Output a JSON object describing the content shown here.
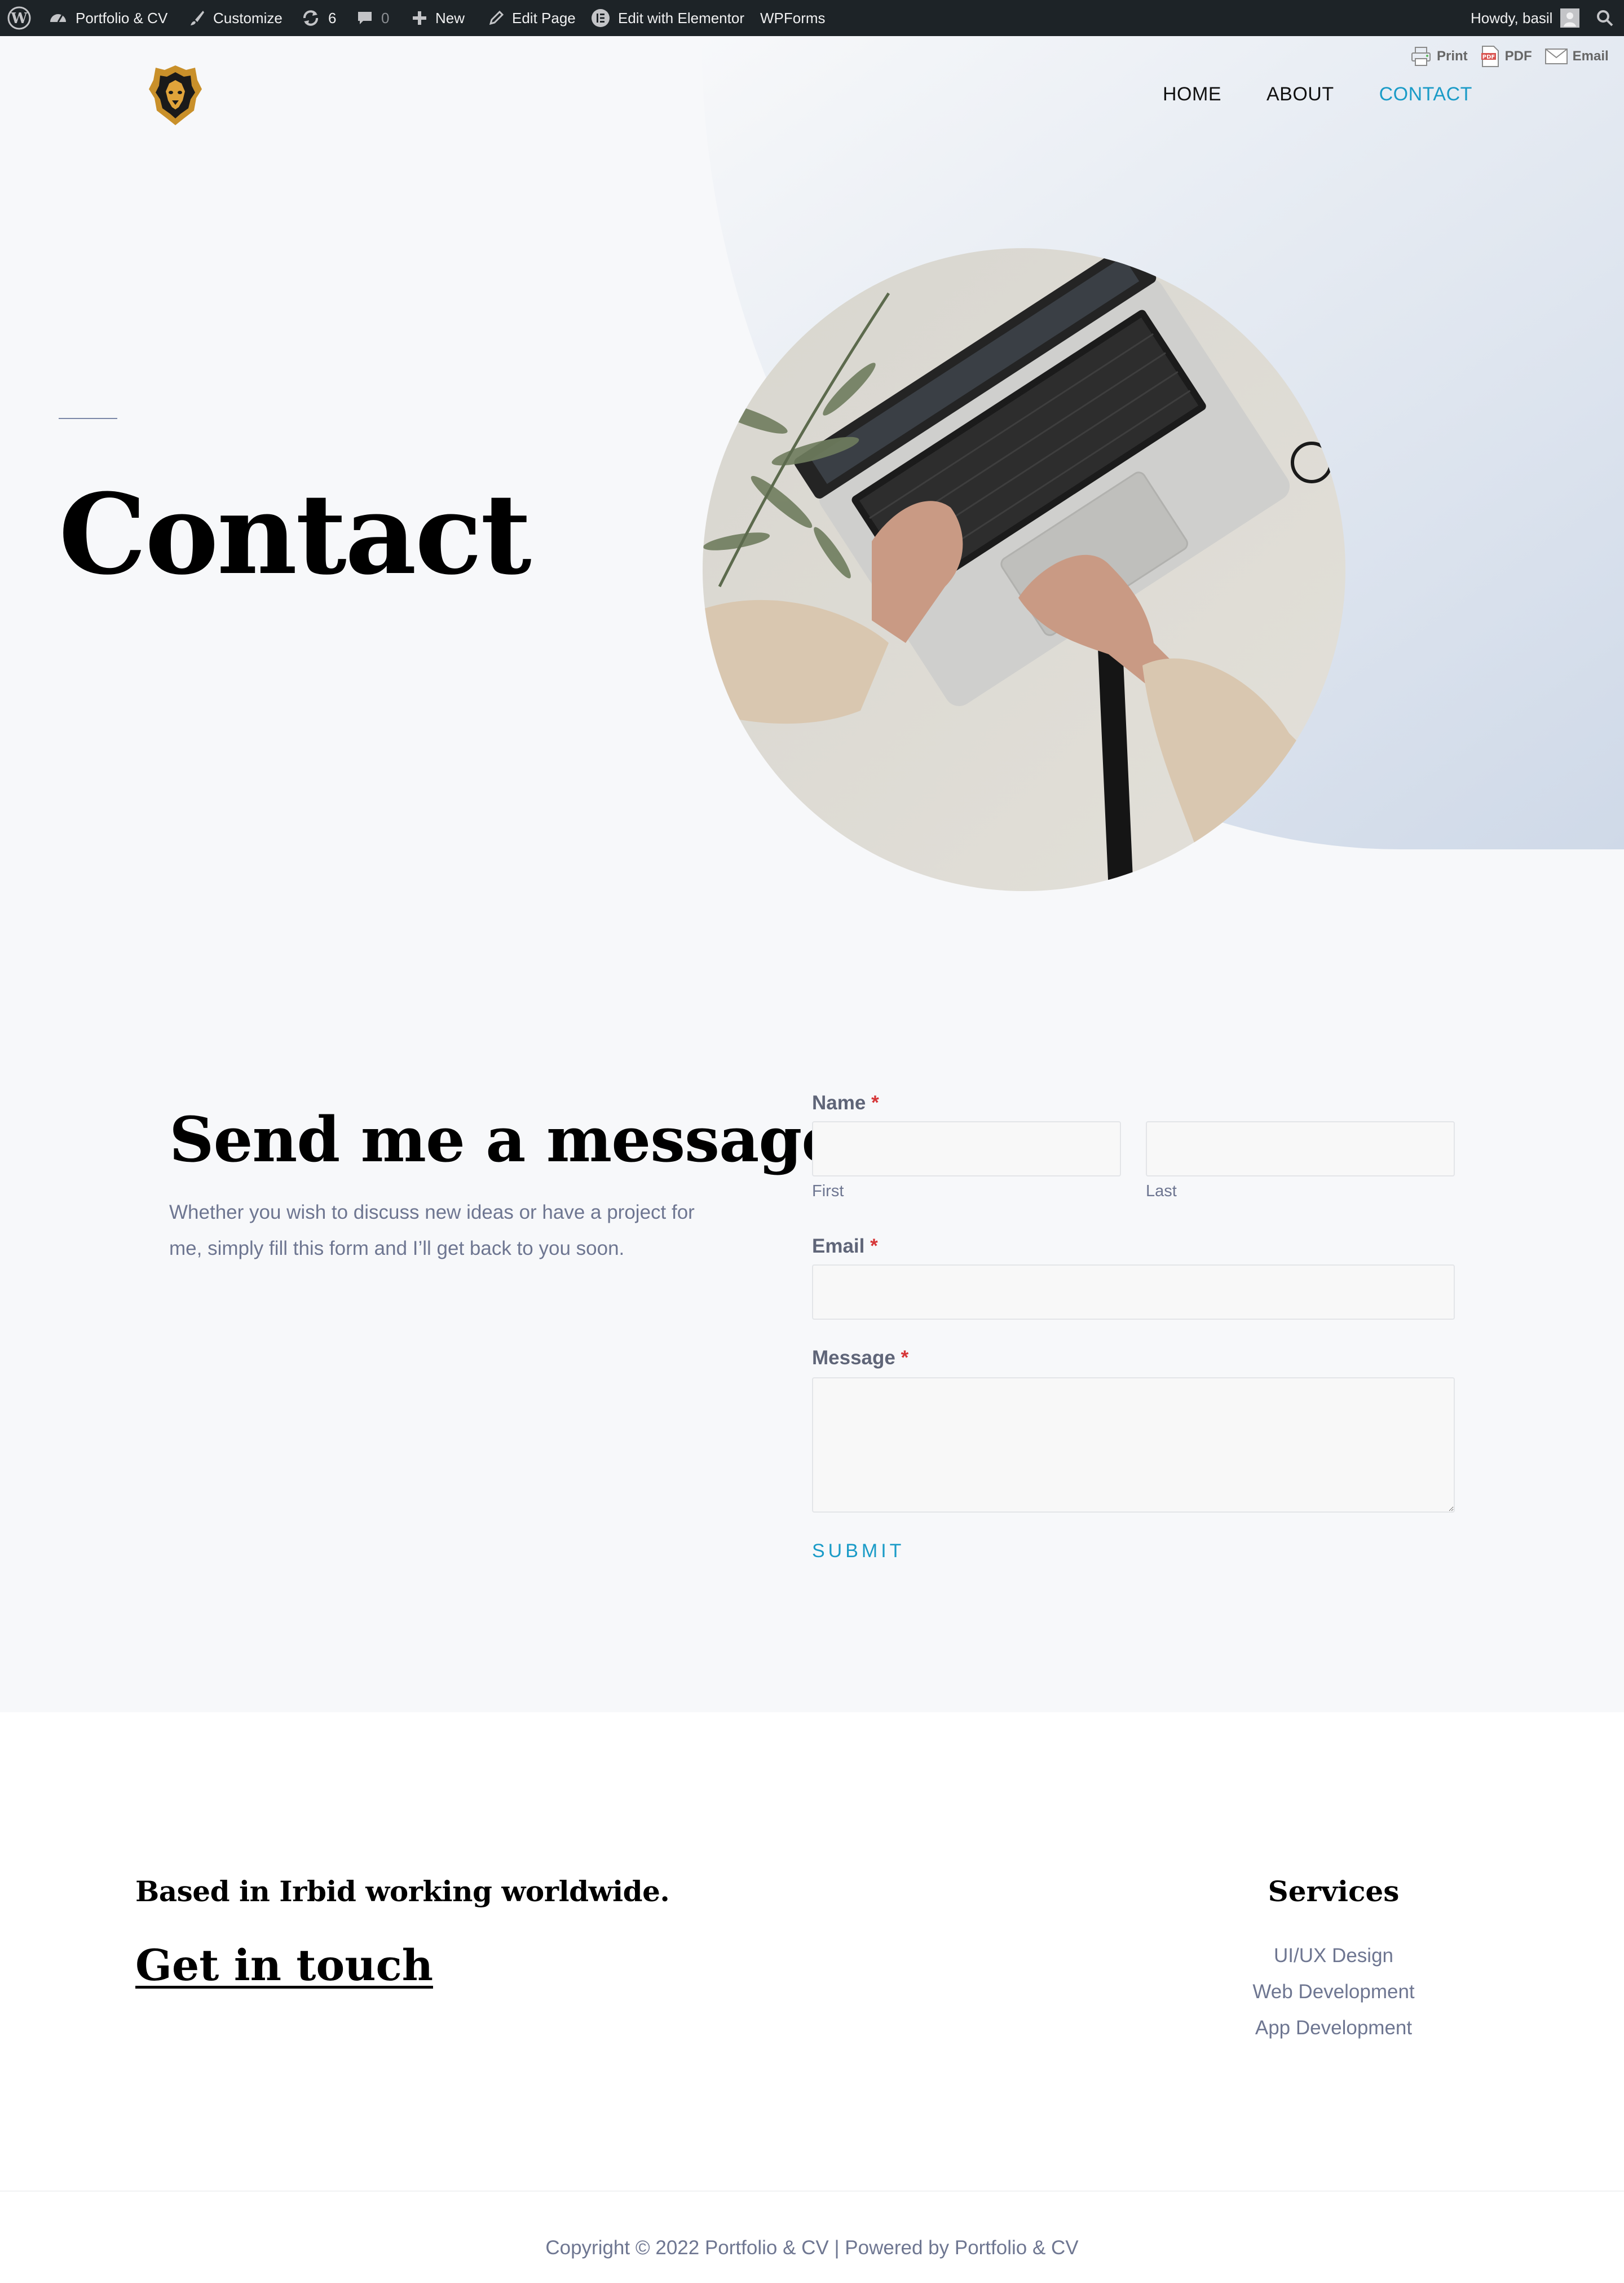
{
  "admin_bar": {
    "site_name": "Portfolio & CV",
    "customize": "Customize",
    "updates": "6",
    "comments": "0",
    "new": "New",
    "edit_page": "Edit Page",
    "elementor": "Edit with Elementor",
    "wpforms": "WPForms",
    "howdy": "Howdy, basil"
  },
  "print_tools": {
    "print": "Print",
    "pdf": "PDF",
    "email": "Email"
  },
  "nav": {
    "home": "HOME",
    "about": "ABOUT",
    "contact": "CONTACT"
  },
  "hero": {
    "title": "Contact"
  },
  "message": {
    "title": "Send me a message",
    "description": "Whether you wish to discuss new ideas or have a project for me, simply fill this form and I’ll get back to you soon."
  },
  "form": {
    "name_label": "Name",
    "first_sublabel": "First",
    "last_sublabel": "Last",
    "email_label": "Email",
    "message_label": "Message",
    "required_mark": "*",
    "submit": "SUBMIT"
  },
  "footer": {
    "tagline": "Based in Irbid working worldwide.",
    "get_in_touch": "Get in touch",
    "services_title": "Services",
    "services": [
      "UI/UX Design",
      "Web Development",
      "App Development"
    ],
    "copyright": "Copyright © 2022 Portfolio & CV | Powered by Portfolio & CV"
  },
  "colors": {
    "accent": "#1a9bc7",
    "admin_bar": "#1d2327",
    "page_bg": "#f7f8fa",
    "required": "#d63638"
  }
}
